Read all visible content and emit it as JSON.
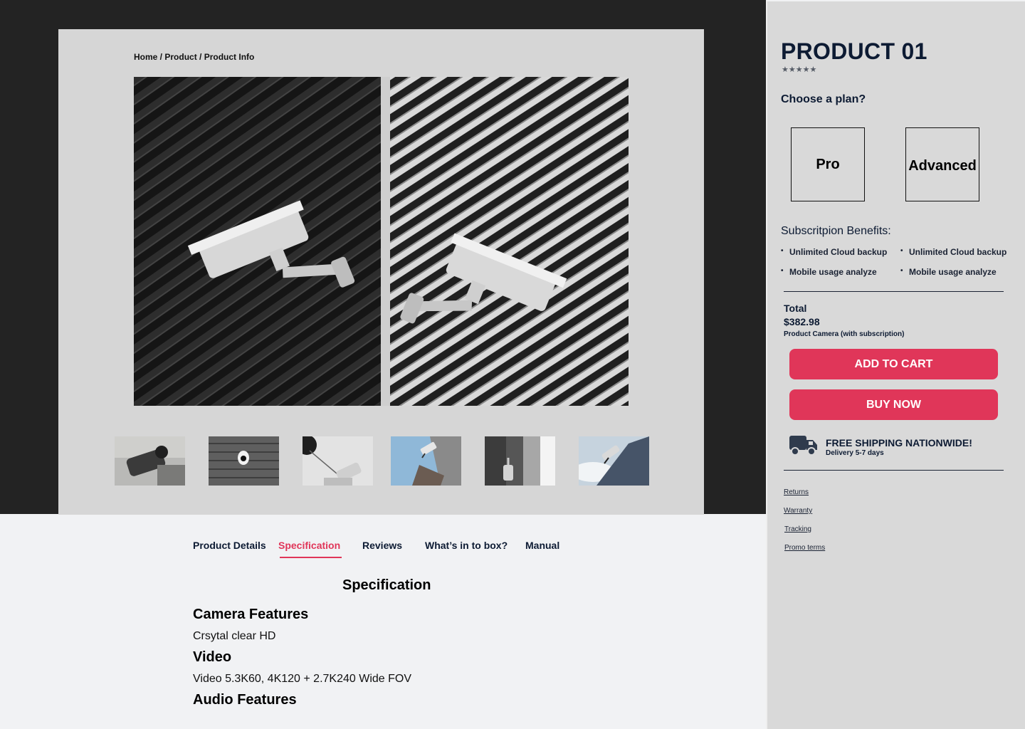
{
  "breadcrumb": {
    "home": "Home",
    "sep1": " / ",
    "product": "Product",
    "sep2": " / ",
    "current": "Product Info"
  },
  "tabs": [
    {
      "label": "Product Details"
    },
    {
      "label": "Specification"
    },
    {
      "label": "Reviews"
    },
    {
      "label": "What’s in to box?"
    },
    {
      "label": "Manual"
    }
  ],
  "spec": {
    "title": "Specification",
    "sections": [
      {
        "heading": "Camera Features",
        "text": "Crsytal clear HD"
      },
      {
        "heading": "Video",
        "text": "Video 5.3K60, 4K120 + 2.7K240 Wide FOV"
      },
      {
        "heading": "Audio Features",
        "text": ""
      }
    ]
  },
  "product": {
    "title": "PRODUCT 01",
    "stars": "★★★★★",
    "choose_label": "Choose a plan?",
    "plans": [
      "Pro",
      "Advanced"
    ],
    "benefits_title": "Subscritpion Benefits:",
    "benefits_left": [
      "Unlimited Cloud backup",
      "Mobile usage analyze"
    ],
    "benefits_right": [
      "Unlimited Cloud backup",
      "Mobile usage analyze"
    ],
    "total_label": "Total",
    "total_price": "$382.98",
    "total_desc": "Product Camera (with subscription)",
    "add_to_cart": "ADD TO CART",
    "buy_now": "BUY NOW",
    "shipping_title": "FREE SHIPPING NATIONWIDE!",
    "shipping_sub": "Delivery 5-7 days",
    "links": [
      "Returns",
      "Warranty",
      "Tracking",
      "Promo terms"
    ]
  },
  "colors": {
    "accent": "#e03659",
    "navy": "#0d1b33",
    "panel_bg": "#d9d9d9",
    "dark_band": "#232323"
  },
  "icons": {
    "stars": "star-icon",
    "shipping": "truck-icon"
  }
}
